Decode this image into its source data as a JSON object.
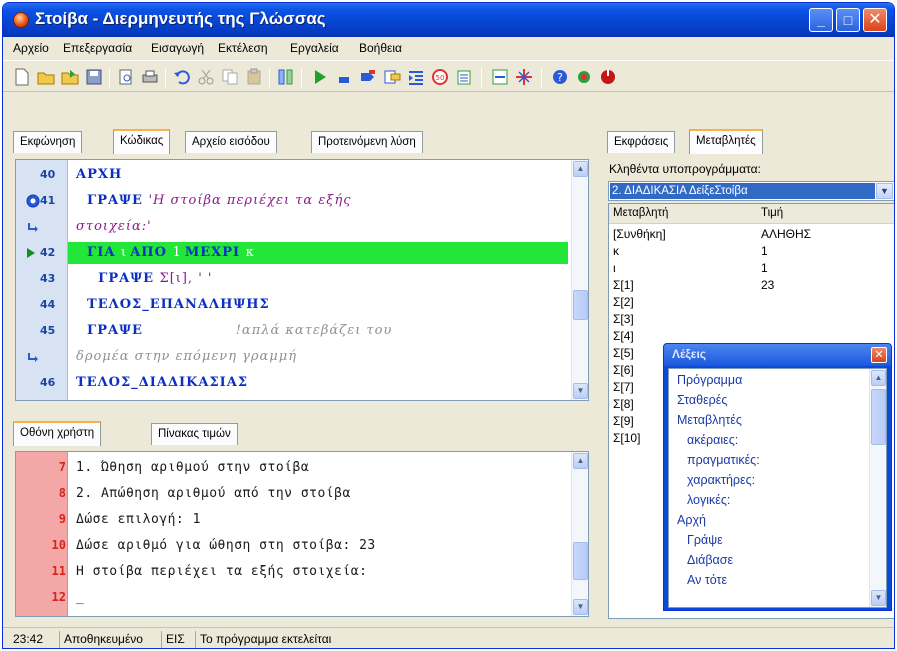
{
  "window": {
    "title": "Στοίβα - Διερμηνευτής της Γλώσσας"
  },
  "menu": [
    "Αρχείο",
    "Επεξεργασία",
    "Εισαγωγή",
    "Εκτέλεση",
    "Εργαλεία",
    "Βοήθεια"
  ],
  "toolbar_icons": [
    "new-file-icon",
    "open-folder-icon",
    "open-icon",
    "save-icon",
    "print-preview-icon",
    "print-icon",
    "undo-icon",
    "cut-icon",
    "copy-icon",
    "paste-icon",
    "columns-icon",
    "run-icon",
    "step-icon",
    "step-into-icon",
    "trace-icon",
    "indent-icon",
    "stop-icon",
    "variables-icon",
    "watch-icon",
    "breakpoint-icon",
    "help-icon",
    "tools-icon",
    "exit-icon"
  ],
  "left_tabs": [
    "Εκφώνηση",
    "Κώδικας",
    "Αρχείο εισόδου",
    "Προτεινόμενη λύση"
  ],
  "left_active_tab": "Κώδικας",
  "code_lines": [
    {
      "ln": "40",
      "parts": [
        [
          "kw",
          "ΑΡΧΗ"
        ]
      ]
    },
    {
      "ln": "41",
      "icon": "breakpoint",
      "parts": [
        [
          "kw",
          "  ΓΡΑΨΕ "
        ],
        [
          "str",
          "'Η στοίβα περιέχει τα εξής"
        ]
      ]
    },
    {
      "ln": "",
      "icon": "wrap",
      "parts": [
        [
          "str",
          "στοιχεία:'"
        ]
      ]
    },
    {
      "ln": "42",
      "icon": "current",
      "highlight": true,
      "parts": [
        [
          "kw",
          "  ΓΙΑ "
        ],
        [
          "var",
          "ι "
        ],
        [
          "kw",
          "ΑΠΟ "
        ],
        [
          "var",
          "1 "
        ],
        [
          "kw",
          "ΜΕΧΡΙ "
        ],
        [
          "var",
          "κ"
        ]
      ]
    },
    {
      "ln": "43",
      "parts": [
        [
          "kw",
          "    ΓΡΑΨΕ "
        ],
        [
          "plain",
          "Σ[ι], ' '"
        ]
      ]
    },
    {
      "ln": "44",
      "parts": [
        [
          "kw",
          "  ΤΕΛΟΣ_ΕΠΑΝΑΛΗΨΗΣ"
        ]
      ]
    },
    {
      "ln": "45",
      "parts": [
        [
          "kw",
          "  ΓΡΑΨΕ "
        ],
        [
          "cmt",
          "                 !απλά κατεβάζει του"
        ]
      ]
    },
    {
      "ln": "",
      "icon": "wrap",
      "parts": [
        [
          "cmt",
          "δρομέα στην επόμενη γραμμή"
        ]
      ]
    },
    {
      "ln": "46",
      "parts": [
        [
          "kw",
          "ΤΕΛΟΣ_ΔΙΑΔΙΚΑΣΙΑΣ"
        ]
      ]
    }
  ],
  "output_tabs": [
    "Οθόνη χρήστη",
    "Πίνακας τιμών"
  ],
  "output_active_tab": "Οθόνη χρήστη",
  "output_lines": [
    {
      "ln": "7",
      "text": "1. Ώθηση αριθμού στην στοίβα"
    },
    {
      "ln": "8",
      "text": "2. Απώθηση αριθμού από την στοίβα"
    },
    {
      "ln": "9",
      "text": "Δώσε επιλογή: 1"
    },
    {
      "ln": "10",
      "text": "Δώσε αριθμό για ώθηση στη στοίβα: 23"
    },
    {
      "ln": "11",
      "text": "Η στοίβα περιέχει τα εξής στοιχεία:"
    },
    {
      "ln": "12",
      "text": "_"
    }
  ],
  "right_tabs": [
    "Εκφράσεις",
    "Μεταβλητές"
  ],
  "right_active_tab": "Μεταβλητές",
  "called_subprograms_label": "Κληθέντα υποπρογράμματα:",
  "called_subprogram_value": "2. ΔΙΑΔΙΚΑΣΙΑ ΔείξεΣτοίβα",
  "vars_header": {
    "name": "Μεταβλητή",
    "value": "Τιμή"
  },
  "variables": [
    {
      "name": "[Συνθήκη]",
      "value": "ΑΛΗΘΗΣ"
    },
    {
      "name": "κ",
      "value": "1"
    },
    {
      "name": "ι",
      "value": "1"
    },
    {
      "name": "Σ[1]",
      "value": "23"
    },
    {
      "name": "Σ[2]",
      "value": ""
    },
    {
      "name": "Σ[3]",
      "value": ""
    },
    {
      "name": "Σ[4]",
      "value": ""
    },
    {
      "name": "Σ[5]",
      "value": ""
    },
    {
      "name": "Σ[6]",
      "value": ""
    },
    {
      "name": "Σ[7]",
      "value": ""
    },
    {
      "name": "Σ[8]",
      "value": ""
    },
    {
      "name": "Σ[9]",
      "value": ""
    },
    {
      "name": "Σ[10]",
      "value": ""
    }
  ],
  "keywords_window": {
    "title": "Λέξεις",
    "items": [
      {
        "text": "Πρόγραμμα",
        "indent": 0
      },
      {
        "text": "Σταθερές",
        "indent": 0
      },
      {
        "text": "Μεταβλητές",
        "indent": 0
      },
      {
        "text": "ακέραιες:",
        "indent": 1
      },
      {
        "text": "πραγματικές:",
        "indent": 1
      },
      {
        "text": "χαρακτήρες:",
        "indent": 1
      },
      {
        "text": "λογικές:",
        "indent": 1
      },
      {
        "text": "Αρχή",
        "indent": 0
      },
      {
        "text": "Γράψε",
        "indent": 1
      },
      {
        "text": "Διάβασε",
        "indent": 1
      },
      {
        "text": "Αν τότε",
        "indent": 1
      }
    ]
  },
  "status": {
    "position": "23:42",
    "saved": "Αποθηκευμένο",
    "mode": "ΕΙΣ",
    "message": "Το πρόγραμμα εκτελείται"
  },
  "colors": {
    "current_line": "#22e63a",
    "keyword": "#0a2fc2",
    "output_gutter": "#f4a7a7",
    "selection": "#316ac5"
  }
}
